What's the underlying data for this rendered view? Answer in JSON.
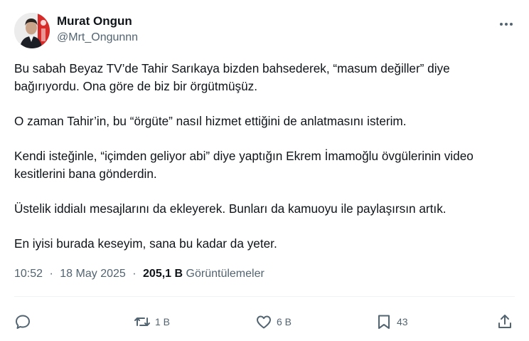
{
  "author": {
    "display_name": "Murat Ongun",
    "handle": "@Mrt_Ongunnn"
  },
  "tweet": {
    "paragraphs": [
      "Bu sabah Beyaz TV’de Tahir Sarıkaya bizden bahsederek, “masum değiller” diye bağırıyordu. Ona göre de biz bir örgütmüşüz.",
      "O zaman Tahir’in, bu “örgüte” nasıl hizmet ettiğini de anlatmasını isterim.",
      "Kendi isteğinle, “içimden geliyor abi” diye yaptığın Ekrem İmamoğlu övgülerinin video kesitlerini bana gönderdin.",
      "Üstelik iddialı mesajlarını da ekleyerek. Bunları da kamuoyu ile paylaşırsın artık.",
      "En iyisi burada keseyim, sana bu kadar da yeter."
    ]
  },
  "meta": {
    "time": "10:52",
    "separator": "·",
    "date": "18 May 2025",
    "views_count": "205,1 B",
    "views_label": "Görüntülemeler"
  },
  "actions": {
    "reply_count": "",
    "retweet_count": "1 B",
    "like_count": "6 B",
    "bookmark_count": "43"
  },
  "icons": {
    "more": "more-horizontal-icon",
    "reply": "reply-icon",
    "retweet": "retweet-icon",
    "like": "heart-icon",
    "bookmark": "bookmark-icon",
    "share": "share-icon"
  },
  "colors": {
    "text": "#0f1419",
    "secondary": "#536471",
    "avatar_accent": "#d62b28"
  }
}
